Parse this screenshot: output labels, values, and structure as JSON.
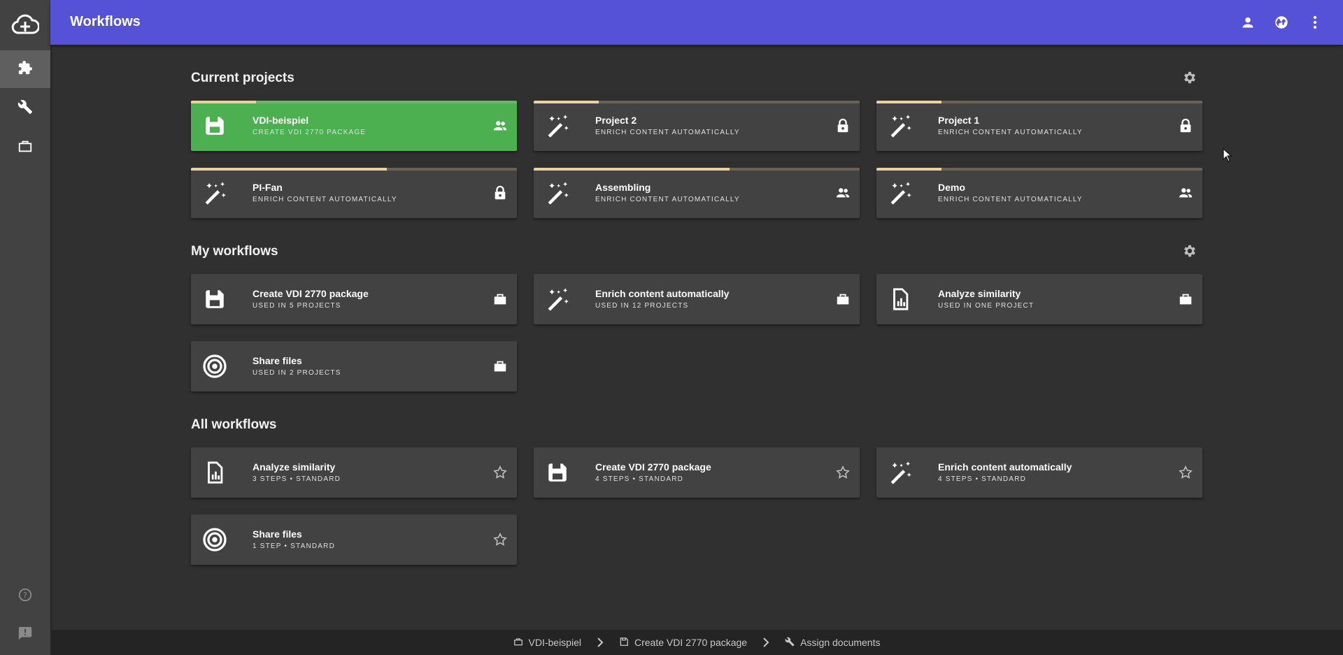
{
  "app": {
    "title": "Workflows"
  },
  "sidebar": {
    "logo": "cloud-plus-icon",
    "items": [
      {
        "name": "puzzle-icon",
        "active": true
      },
      {
        "name": "wrench-icon",
        "active": false
      },
      {
        "name": "briefcase-icon",
        "active": false
      }
    ],
    "bottom": [
      "help-icon",
      "feedback-icon"
    ]
  },
  "topbar": {
    "icons": [
      "account-icon",
      "globe-icon",
      "more-vert-icon"
    ]
  },
  "sections": {
    "current_projects": "Current projects",
    "my_workflows": "My workflows",
    "all_workflows": "All workflows"
  },
  "current_projects": [
    {
      "title": "VDI-beispiel",
      "subtitle": "Create VDI 2770 package",
      "icon": "floppy-icon",
      "action": "group-icon",
      "progress": 0.2,
      "highlight": true
    },
    {
      "title": "Project 2",
      "subtitle": "Enrich content automatically",
      "icon": "magic-wand-icon",
      "action": "lock-icon",
      "progress": 0.2,
      "highlight": false
    },
    {
      "title": "Project 1",
      "subtitle": "Enrich content automatically",
      "icon": "magic-wand-icon",
      "action": "lock-icon",
      "progress": 0.2,
      "highlight": false
    },
    {
      "title": "PI-Fan",
      "subtitle": "Enrich content automatically",
      "icon": "magic-wand-icon",
      "action": "lock-icon",
      "progress": 0.6,
      "highlight": false
    },
    {
      "title": "Assembling",
      "subtitle": "Enrich content automatically",
      "icon": "magic-wand-icon",
      "action": "group-icon",
      "progress": 0.6,
      "highlight": false
    },
    {
      "title": "Demo",
      "subtitle": "Enrich content automatically",
      "icon": "magic-wand-icon",
      "action": "group-icon",
      "progress": 0.2,
      "highlight": false
    }
  ],
  "my_workflows": [
    {
      "title": "Create VDI 2770 package",
      "subtitle": "Used in 5 projects",
      "icon": "floppy-icon",
      "action": "briefcase-icon"
    },
    {
      "title": "Enrich content automatically",
      "subtitle": "Used in 12 projects",
      "icon": "magic-wand-icon",
      "action": "briefcase-icon"
    },
    {
      "title": "Analyze similarity",
      "subtitle": "Used in one project",
      "icon": "file-chart-icon",
      "action": "briefcase-icon"
    },
    {
      "title": "Share files",
      "subtitle": "Used in 2 projects",
      "icon": "target-icon",
      "action": "briefcase-icon"
    }
  ],
  "all_workflows": [
    {
      "title": "Analyze similarity",
      "subtitle": "3 steps • Standard",
      "icon": "file-chart-icon",
      "action": "star-outline-icon"
    },
    {
      "title": "Create VDI 2770 package",
      "subtitle": "4 steps • Standard",
      "icon": "floppy-icon",
      "action": "star-outline-icon"
    },
    {
      "title": "Enrich content automatically",
      "subtitle": "4 steps • Standard",
      "icon": "magic-wand-icon",
      "action": "star-outline-icon"
    },
    {
      "title": "Share files",
      "subtitle": "1 step • Standard",
      "icon": "target-icon",
      "action": "star-outline-icon"
    }
  ],
  "breadcrumb": [
    {
      "label": "VDI-beispiel",
      "icon": "briefcase-outline-icon"
    },
    {
      "label": "Create VDI 2770 package",
      "icon": "floppy-outline-icon"
    },
    {
      "label": "Assign documents",
      "icon": "wrench-icon"
    }
  ],
  "colors": {
    "topbar": "#5552d8",
    "highlight": "#4caf50",
    "progress": "#e8d39a"
  }
}
